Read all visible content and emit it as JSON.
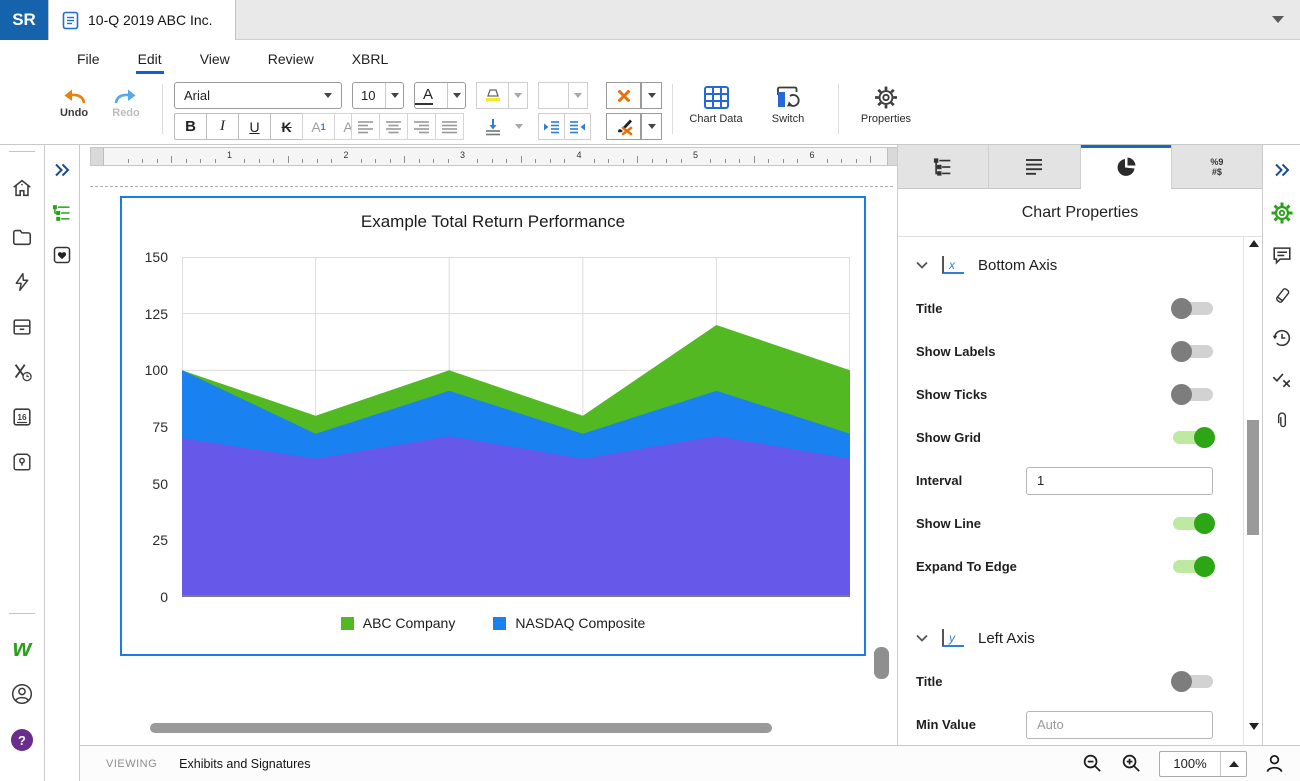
{
  "header": {
    "logo": "SR",
    "tab_title": "10-Q 2019 ABC Inc."
  },
  "menu": {
    "items": [
      {
        "label": "File",
        "active": false
      },
      {
        "label": "Edit",
        "active": true
      },
      {
        "label": "View",
        "active": false
      },
      {
        "label": "Review",
        "active": false
      },
      {
        "label": "XBRL",
        "active": false
      }
    ]
  },
  "toolbar": {
    "undo_label": "Undo",
    "redo_label": "Redo",
    "font_family": "Arial",
    "font_size": "10",
    "format_buttons": [
      {
        "t": "B",
        "style": "fb-b",
        "enabled": true
      },
      {
        "t": "I",
        "style": "fb-i",
        "enabled": true
      },
      {
        "t": "U",
        "style": "fb-u",
        "enabled": true
      },
      {
        "t": "K",
        "style": "fb-k",
        "enabled": true
      },
      {
        "t": "A",
        "mark": "1",
        "pos": "sup",
        "style": "fb-gray",
        "enabled": false
      },
      {
        "t": "A",
        "mark": "1",
        "pos": "sub",
        "style": "fb-gray",
        "enabled": false
      }
    ],
    "chart_data_label": "Chart Data",
    "switch_label": "Switch",
    "properties_label": "Properties"
  },
  "ruler": {
    "numbers": [
      "1",
      "2",
      "3",
      "4",
      "5",
      "6"
    ]
  },
  "chart_data": {
    "type": "area",
    "title": "Example Total Return Performance",
    "x_count": 6,
    "ylim": [
      0,
      150
    ],
    "y_ticks": [
      150,
      125,
      100,
      75,
      50,
      25,
      0
    ],
    "grid": true,
    "expand_to_edge": true,
    "legend_position": "bottom",
    "series": [
      {
        "name": "ABC Company",
        "color": "#52b922",
        "values": [
          100,
          80,
          100,
          80,
          120,
          100
        ],
        "in_legend": true
      },
      {
        "name": "NASDAQ Composite",
        "color": "#1a82f0",
        "values": [
          100,
          72,
          91,
          72,
          91,
          72
        ],
        "in_legend": true
      },
      {
        "name": "",
        "color": "#6658e8",
        "values": [
          70,
          61,
          71,
          61,
          71,
          61
        ],
        "in_legend": false
      }
    ]
  },
  "panel": {
    "title": "Chart Properties",
    "tabs": [
      {
        "icon": "hierarchy",
        "active": false
      },
      {
        "icon": "paragraph",
        "active": false
      },
      {
        "icon": "pie-chart",
        "active": true
      },
      {
        "icon": "number-format",
        "active": false
      }
    ],
    "number_format_glyphs": [
      "%9",
      "#$"
    ],
    "sections": [
      {
        "label": "Bottom Axis",
        "glyph": "x",
        "rows": [
          {
            "label": "Title",
            "type": "toggle",
            "value": false
          },
          {
            "label": "Show Labels",
            "type": "toggle",
            "value": false
          },
          {
            "label": "Show Ticks",
            "type": "toggle",
            "value": false
          },
          {
            "label": "Show Grid",
            "type": "toggle",
            "value": true
          },
          {
            "label": "Interval",
            "type": "input",
            "value": "1",
            "placeholder": ""
          },
          {
            "label": "Show Line",
            "type": "toggle",
            "value": true
          },
          {
            "label": "Expand To Edge",
            "type": "toggle",
            "value": true
          }
        ]
      },
      {
        "label": "Left Axis",
        "glyph": "y",
        "rows": [
          {
            "label": "Title",
            "type": "toggle",
            "value": false
          },
          {
            "label": "Min Value",
            "type": "input",
            "value": "",
            "placeholder": "Auto"
          }
        ]
      }
    ]
  },
  "left_rail_icons": [
    "home-icon",
    "folder-icon",
    "lightning-icon",
    "archive-icon",
    "strike-clock-icon",
    "calendar-icon",
    "pin-box-icon"
  ],
  "calendar_day": "16",
  "status_bar": {
    "viewing_label": "VIEWING",
    "document_section": "Exhibits and Signatures",
    "zoom_value": "100%"
  },
  "colors": {
    "brand_blue": "#1463ac",
    "accent_blue": "#1669c1",
    "accent_green": "#2ca01c",
    "selection_blue": "#1b7be4",
    "toggle_on": "#2ca614",
    "orange": "#e8820c",
    "help_purple": "#6b2d8b"
  }
}
